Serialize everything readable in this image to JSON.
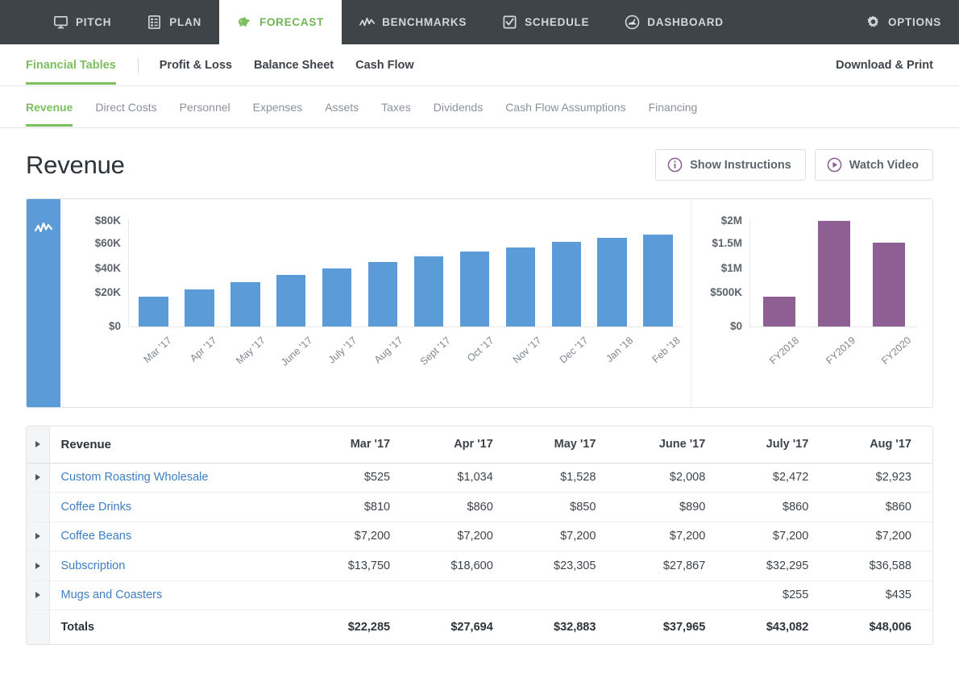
{
  "topnav": {
    "items": [
      {
        "label": "PITCH",
        "icon": "monitor-icon",
        "active": false
      },
      {
        "label": "PLAN",
        "icon": "document-list-icon",
        "active": false
      },
      {
        "label": "FORECAST",
        "icon": "piggy-bank-icon",
        "active": true
      },
      {
        "label": "BENCHMARKS",
        "icon": "line-chart-icon",
        "active": false
      },
      {
        "label": "SCHEDULE",
        "icon": "checkbox-icon",
        "active": false
      },
      {
        "label": "DASHBOARD",
        "icon": "gauge-icon",
        "active": false
      },
      {
        "label": "OPTIONS",
        "icon": "gear-icon",
        "active": false
      }
    ]
  },
  "subnav": {
    "items": [
      {
        "label": "Financial Tables",
        "active": true
      },
      {
        "label": "Profit & Loss",
        "active": false
      },
      {
        "label": "Balance Sheet",
        "active": false
      },
      {
        "label": "Cash Flow",
        "active": false
      }
    ],
    "download_print": "Download & Print"
  },
  "tabnav": {
    "items": [
      {
        "label": "Revenue",
        "active": true
      },
      {
        "label": "Direct Costs",
        "active": false
      },
      {
        "label": "Personnel",
        "active": false
      },
      {
        "label": "Expenses",
        "active": false
      },
      {
        "label": "Assets",
        "active": false
      },
      {
        "label": "Taxes",
        "active": false
      },
      {
        "label": "Dividends",
        "active": false
      },
      {
        "label": "Cash Flow Assumptions",
        "active": false
      },
      {
        "label": "Financing",
        "active": false
      }
    ]
  },
  "page": {
    "title": "Revenue",
    "show_instructions": "Show Instructions",
    "watch_video": "Watch Video"
  },
  "colors": {
    "accent_green": "#7cbf5e",
    "chart_blue": "#5b9bd8",
    "chart_purple": "#8e5f92",
    "link_blue": "#3f7fc1",
    "topnav_bg": "#3f4448",
    "button_purple": "#8e5f92"
  },
  "chart_panel": {
    "side_tab_icon": "line-chart-icon"
  },
  "chart_data": [
    {
      "type": "bar",
      "title": "",
      "xlabel": "",
      "ylabel": "",
      "categories": [
        "Mar '17",
        "Apr '17",
        "May '17",
        "June '17",
        "July '17",
        "Aug '17",
        "Sept '17",
        "Oct '17",
        "Nov '17",
        "Dec '17",
        "Jan '18",
        "Feb '18"
      ],
      "values": [
        22285,
        27694,
        32883,
        37965,
        43082,
        48006,
        52000,
        55500,
        58500,
        62500,
        65500,
        68000
      ],
      "ytick_labels": [
        "$80K",
        "$60K",
        "$40K",
        "$20K",
        "$0"
      ],
      "ylim": [
        0,
        80000
      ],
      "grid": false,
      "legend": false,
      "color": "#5b9bd8"
    },
    {
      "type": "bar",
      "title": "",
      "xlabel": "",
      "ylabel": "",
      "categories": [
        "FY2018",
        "FY2019",
        "FY2020"
      ],
      "values": [
        550000,
        1950000,
        1550000
      ],
      "ytick_labels": [
        "$2M",
        "$1.5M",
        "$1M",
        "$500K",
        "$0"
      ],
      "ylim": [
        0,
        2000000
      ],
      "grid": false,
      "legend": false,
      "color": "#8e5f92"
    }
  ],
  "table": {
    "columns": [
      "Revenue",
      "Mar '17",
      "Apr '17",
      "May '17",
      "June '17",
      "July '17",
      "Aug '17"
    ],
    "rows": [
      {
        "name": "Custom Roasting Wholesale",
        "expandable": true,
        "link": true,
        "values": [
          "$525",
          "$1,034",
          "$1,528",
          "$2,008",
          "$2,472",
          "$2,923"
        ]
      },
      {
        "name": "Coffee Drinks",
        "expandable": false,
        "link": true,
        "values": [
          "$810",
          "$860",
          "$850",
          "$890",
          "$860",
          "$860"
        ]
      },
      {
        "name": "Coffee Beans",
        "expandable": true,
        "link": true,
        "values": [
          "$7,200",
          "$7,200",
          "$7,200",
          "$7,200",
          "$7,200",
          "$7,200"
        ]
      },
      {
        "name": "Subscription",
        "expandable": true,
        "link": true,
        "values": [
          "$13,750",
          "$18,600",
          "$23,305",
          "$27,867",
          "$32,295",
          "$36,588"
        ]
      },
      {
        "name": "Mugs and Coasters",
        "expandable": true,
        "link": true,
        "values": [
          "",
          "",
          "",
          "",
          "$255",
          "$435"
        ]
      }
    ],
    "totals": {
      "name": "Totals",
      "expandable": false,
      "link": false,
      "values": [
        "$22,285",
        "$27,694",
        "$32,883",
        "$37,965",
        "$43,082",
        "$48,006"
      ]
    }
  }
}
